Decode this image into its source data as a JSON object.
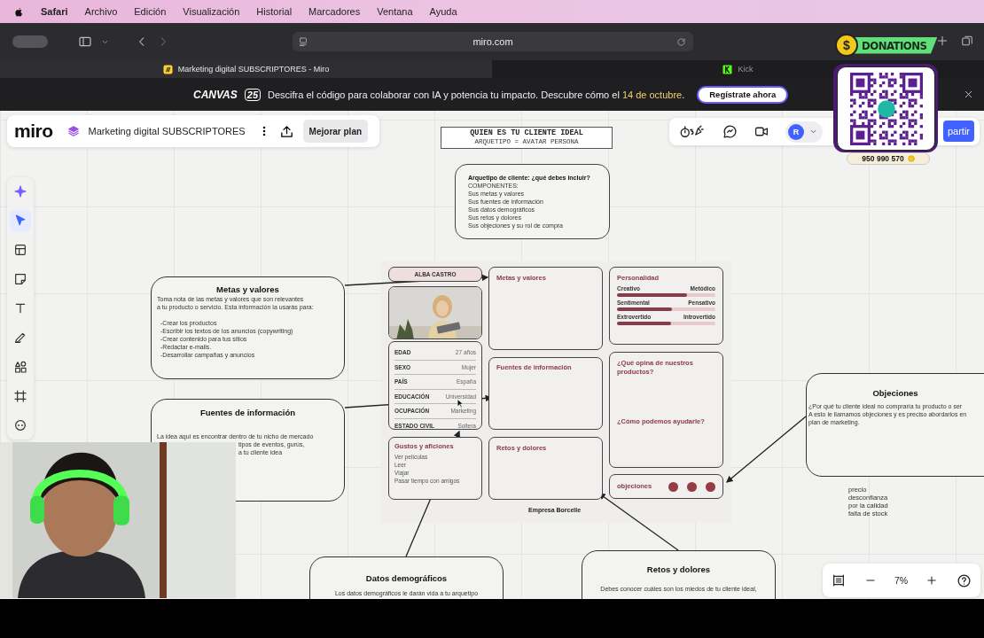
{
  "menu_bar": {
    "app": "Safari",
    "items": [
      "Archivo",
      "Edición",
      "Visualización",
      "Historial",
      "Marcadores",
      "Ventana",
      "Ayuda"
    ]
  },
  "browser": {
    "url": "miro.com",
    "tabs": [
      {
        "title": "Marketing digital SUBSCRIPTORES - Miro",
        "kind": "miro",
        "selected": true
      },
      {
        "title": "Kick",
        "kind": "kick",
        "selected": false
      }
    ]
  },
  "banner": {
    "logo": "CANVAS",
    "logo_badge": "25",
    "text_before": "Descifra el código para colaborar con IA y potencia tu impacto. Descubre cómo el ",
    "highlight": "14 de octubre",
    "text_after": ".",
    "button": "Regístrate ahora"
  },
  "board_header": {
    "logo": "miro",
    "board_name": "Marketing digital SUBSCRIPTORES",
    "upgrade_button": "Mejorar plan"
  },
  "collab": {
    "avatar": "R",
    "share_button": "partir"
  },
  "tools": [
    {
      "kind": "sparkle",
      "selected": false
    },
    {
      "kind": "cursor",
      "selected": true
    },
    {
      "kind": "table",
      "selected": false
    },
    {
      "kind": "note",
      "selected": false
    },
    {
      "kind": "text",
      "selected": false
    },
    {
      "kind": "pen",
      "selected": false
    },
    {
      "kind": "shapes",
      "selected": false
    },
    {
      "kind": "frame",
      "selected": false
    },
    {
      "kind": "more",
      "selected": false
    }
  ],
  "title_card": {
    "title": "QUIEN ES TU CLIENTE IDEAL",
    "subtitle": "ARQUETIPO = AVATAR PERSONA"
  },
  "components_card": {
    "heading": "Arquetipo de cliente: ¿qué debes incluir?",
    "lines": [
      "COMPONENTES:",
      "Sus metas y valores",
      "Sus fuentes de información",
      "Sus datos demográficos",
      "Sus retos y dolores",
      "Sus objeciones y su rol de compra"
    ]
  },
  "notes": [
    {
      "title": "Metas y valores",
      "lines": [
        "Toma nota de las metas y valores que son relevantes",
        "a tu producto o servicio. Esta información la usarás para:",
        "-Crear los productos",
        "-Escribir los textos de los anuncios (copywriting)",
        "-Crear contenido para tus sitios",
        "-Redactar e-mails.",
        "-Desarrollar campañas y anuncios"
      ]
    },
    {
      "title": "Fuentes de información",
      "lines": [
        "La idea aquí es encontrar dentro de tu nicho de mercado",
        "tipos de eventos, gurús,",
        "a tu cliente idea"
      ]
    },
    {
      "title": "Objeciones",
      "lines": [
        "¿Por qué tu cliente ideal no compraría tu producto o ser",
        "A esto le llamamos objeciones y es preciso abordarlos en",
        "plan de marketing."
      ]
    },
    {
      "title": "Datos demográficos",
      "lines": [
        "Los datos demográficos le darán vida a tu arquetipo"
      ]
    },
    {
      "title": "Retos y dolores",
      "lines": [
        "Debes conocer cuáles son los miedos de tu cliente ideal,"
      ]
    }
  ],
  "persona": {
    "name": "ALBA CASTRO",
    "photo": {
      "kind": "picture"
    },
    "fields": [
      {
        "label": "EDAD",
        "value": "27 años"
      },
      {
        "label": "SEXO",
        "value": "Mujer"
      },
      {
        "label": "PAÍS",
        "value": "España"
      },
      {
        "label": "EDUCACIÓN",
        "value": "Universidad"
      },
      {
        "label": "OCUPACIÓN",
        "value": "Marketing"
      },
      {
        "label": "ESTADO CIVIL",
        "value": "Soltera"
      }
    ],
    "hobbies": {
      "title": "Gustos y aficiones",
      "items": [
        "Ver películas",
        "Leer",
        "Viajar",
        "Pasar tiempo con amigos"
      ]
    },
    "sections": [
      "Metas y valores",
      "Fuentes de información",
      "Retos y dolores"
    ],
    "personality": {
      "title": "Personalidad",
      "traits": [
        {
          "left": "Creativo",
          "right": "Metódico",
          "level": 0.71
        },
        {
          "left": "Sentimental",
          "right": "Pensativo",
          "level": 0.56
        },
        {
          "left": "Extrovertido",
          "right": "Introvertido",
          "level": 0.55
        }
      ]
    },
    "questions": [
      "¿Qué opina de nuestros productos?",
      "¿Cómo podemos ayudarle?"
    ],
    "objections_label": "objeciones",
    "footer": "Empresa Borcelle"
  },
  "free_text": [
    "precio",
    "desconfianza",
    "por la calidad",
    "falta de stock"
  ],
  "zoom": {
    "level": "7%"
  },
  "donations": {
    "coin": "$",
    "label": "DONATIONS",
    "phone": "950 990 570"
  }
}
